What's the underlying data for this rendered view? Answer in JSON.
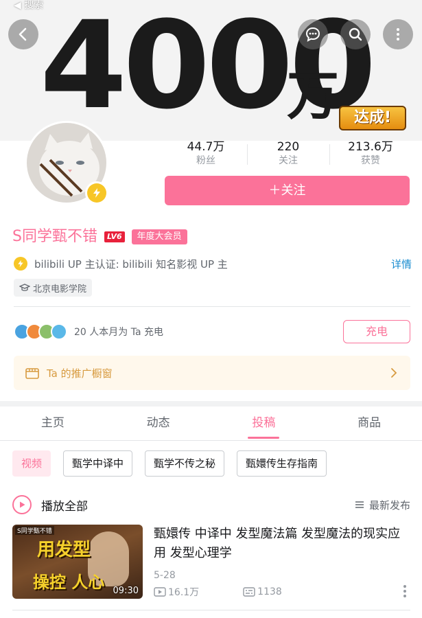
{
  "status_bar": {
    "back_label": "◀ 搜索"
  },
  "banner": {
    "number": "4000",
    "unit": "万",
    "badge": "达成!"
  },
  "nav_icons": [
    "back-arrow-icon",
    "message-icon",
    "search-icon",
    "more-vertical-icon"
  ],
  "stats": [
    {
      "value": "44.7万",
      "label": "粉丝"
    },
    {
      "value": "220",
      "label": "关注"
    },
    {
      "value": "213.6万",
      "label": "获赞"
    }
  ],
  "follow_button": "＋关注",
  "profile": {
    "name": "S同学甄不错",
    "level": "LV6",
    "vip": "年度大会员",
    "certification": "bilibili UP 主认证: bilibili 知名影视 UP 主",
    "cert_more": "详情",
    "school": "北京电影学院"
  },
  "charge": {
    "text": "20 人本月为 Ta 充电",
    "button": "充电"
  },
  "promo": {
    "text": "Ta 的推广橱窗"
  },
  "tabs": [
    "主页",
    "动态",
    "投稿",
    "商品"
  ],
  "active_tab": "投稿",
  "chips": [
    "视频",
    "甄学中译中",
    "甄学不传之秘",
    "甄嬛传生存指南"
  ],
  "play_all": "播放全部",
  "sort": "最新发布",
  "video": {
    "thumb_tag": "S同学甄不错",
    "thumb_line1": "用发型",
    "thumb_line2": "操控 人心",
    "duration": "09:30",
    "title": "甄嬛传 中译中 发型魔法篇 发型魔法的现实应用 发型心理学",
    "date": "5-28",
    "views": "16.1万",
    "danmaku": "1138"
  },
  "colors": {
    "accent": "#fb7299",
    "link": "#178bcf",
    "promo_text": "#d79a3f",
    "badge_yellow": "#f7c627"
  }
}
